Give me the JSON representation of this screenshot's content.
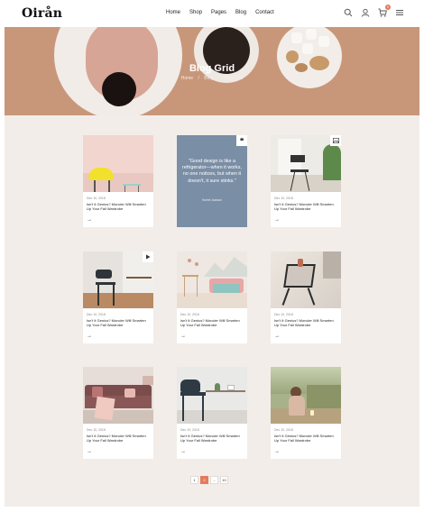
{
  "header": {
    "logo": "Oirån",
    "nav": [
      "Home",
      "Shop",
      "Pages",
      "Blog",
      "Contact"
    ],
    "cart_count": "0"
  },
  "hero": {
    "title": "Blog Grid",
    "breadcrumbs": [
      "Home",
      "/",
      "Blog",
      "/",
      "Blog Grid"
    ]
  },
  "posts": [
    {
      "date": "Dec 10, 2018",
      "title": "Isn't It Genius? Moncler Will Smarten Up Your Fall Wardrobe",
      "arrow": "→"
    },
    {
      "date": "Dec 10, 2018",
      "title": "Isn't It Genius? Moncler Will Smarten Up Your Fall Wardrobe",
      "arrow": "→"
    },
    {
      "date": "Dec 10, 2018",
      "title": "Isn't It Genius? Moncler Will Smarten Up Your Fall Wardrobe",
      "arrow": "→"
    },
    {
      "date": "Dec 10, 2018",
      "title": "Isn't It Genius? Moncler Will Smarten Up Your Fall Wardrobe",
      "arrow": "→"
    },
    {
      "date": "Dec 10, 2018",
      "title": "Isn't It Genius? Moncler Will Smarten Up Your Fall Wardrobe",
      "arrow": "→"
    },
    {
      "date": "Dec 10, 2018",
      "title": "Isn't It Genius? Moncler Will Smarten Up Your Fall Wardrobe",
      "arrow": "→"
    },
    {
      "date": "Dec 10, 2018",
      "title": "Isn't It Genius? Moncler Will Smarten Up Your Fall Wardrobe",
      "arrow": "→"
    },
    {
      "date": "Dec 10, 2018",
      "title": "Isn't It Genius? Moncler Will Smarten Up Your Fall Wardrobe",
      "arrow": "→"
    }
  ],
  "quote": {
    "mark": "❝",
    "text": "\"Good design is like a refrigerator—when it works, no one notices, but when it doesn't, it sure stinks.\"",
    "author": "Harriet Jackson"
  },
  "pagination": {
    "items": [
      "1",
      "2",
      "...",
      "10"
    ],
    "active": "2"
  },
  "icons": {
    "search": "search-icon",
    "account": "user-icon",
    "cart": "cart-icon",
    "menu": "menu-icon",
    "video": "play-icon",
    "gallery": "image-icon",
    "quote": "quote-icon"
  },
  "colors": {
    "accent": "#e57a5e",
    "quote_bg": "#7a8ea6",
    "content_bg": "#f2ede9",
    "hero_bg": "#c8977a"
  }
}
